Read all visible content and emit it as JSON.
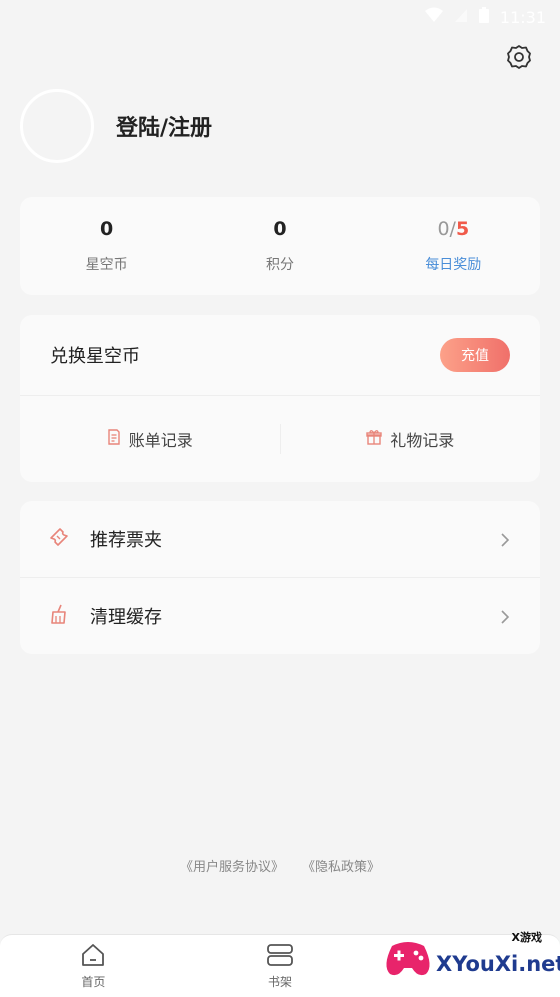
{
  "status_bar": {
    "time": "11:31"
  },
  "profile": {
    "login_label": "登陆/注册"
  },
  "stats": [
    {
      "value": "0",
      "label": "星空币"
    },
    {
      "value": "0",
      "label": "积分"
    },
    {
      "value_current": "0/",
      "value_total": "5",
      "label": "每日奖励"
    }
  ],
  "exchange": {
    "title": "兑换星空币",
    "recharge_label": "充值",
    "bill_label": "账单记录",
    "gift_label": "礼物记录"
  },
  "menu": {
    "tickets_label": "推荐票夹",
    "cache_label": "清理缓存"
  },
  "footer": {
    "agreement": "《用户服务协议》",
    "privacy": "《隐私政策》"
  },
  "nav": {
    "home": "首页",
    "shelf": "书架"
  },
  "watermark": {
    "brand": "XYouXi.net",
    "small": "X游戏"
  },
  "colors": {
    "accent_red": "#f05a4a",
    "accent_blue": "#4a8ed8",
    "recharge_gradient_start": "#fca189",
    "recharge_gradient_end": "#f0706a"
  }
}
